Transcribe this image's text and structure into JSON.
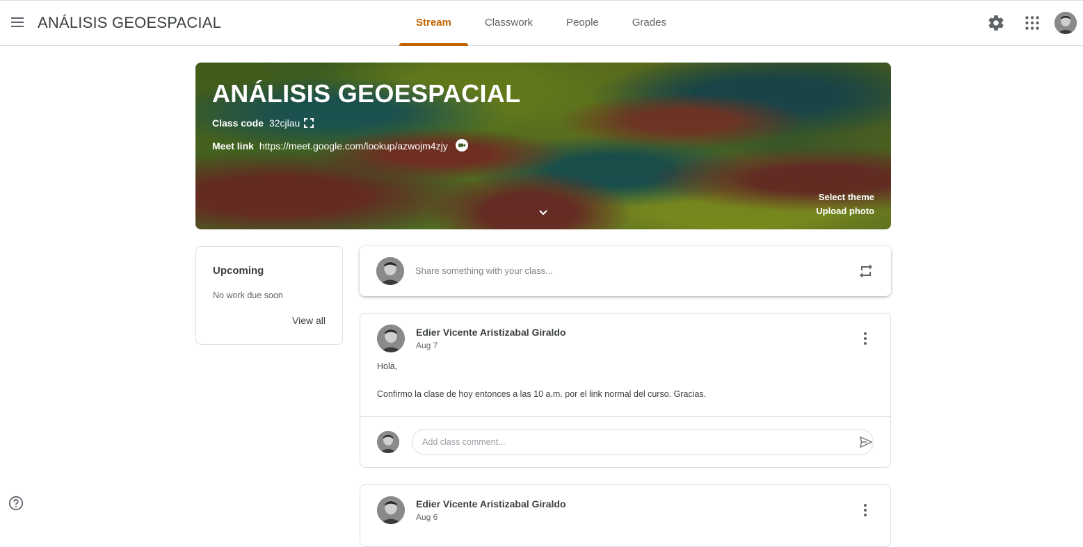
{
  "app": {
    "title": "ANÁLISIS GEOESPACIAL"
  },
  "tabs": [
    {
      "label": "Stream",
      "active": true
    },
    {
      "label": "Classwork",
      "active": false
    },
    {
      "label": "People",
      "active": false
    },
    {
      "label": "Grades",
      "active": false
    }
  ],
  "header_icons": [
    "menu-icon",
    "gear-icon",
    "apps-grid-icon",
    "account-avatar"
  ],
  "banner": {
    "title": "ANÁLISIS GEOESPACIAL",
    "class_code_label": "Class code",
    "class_code": "32cjlau",
    "meet_label": "Meet link",
    "meet_url": "https://meet.google.com/lookup/azwojm4zjy",
    "select_theme": "Select theme",
    "upload_photo": "Upload photo"
  },
  "upcoming": {
    "title": "Upcoming",
    "status": "No work due soon",
    "view_all": "View all"
  },
  "share": {
    "placeholder": "Share something with your class..."
  },
  "posts": [
    {
      "author": "Edier Vicente Aristizabal Giraldo",
      "date": "Aug 7",
      "greeting": "Hola,",
      "message": "Confirmo la clase de hoy entonces a las 10 a.m. por el link normal del curso. Gracias.",
      "comment_placeholder": "Add class comment..."
    },
    {
      "author": "Edier Vicente Aristizabal Giraldo",
      "date": "Aug 6"
    }
  ],
  "colors": {
    "accent": "#c26401",
    "border": "#dadce0",
    "text": "#3c4043"
  }
}
